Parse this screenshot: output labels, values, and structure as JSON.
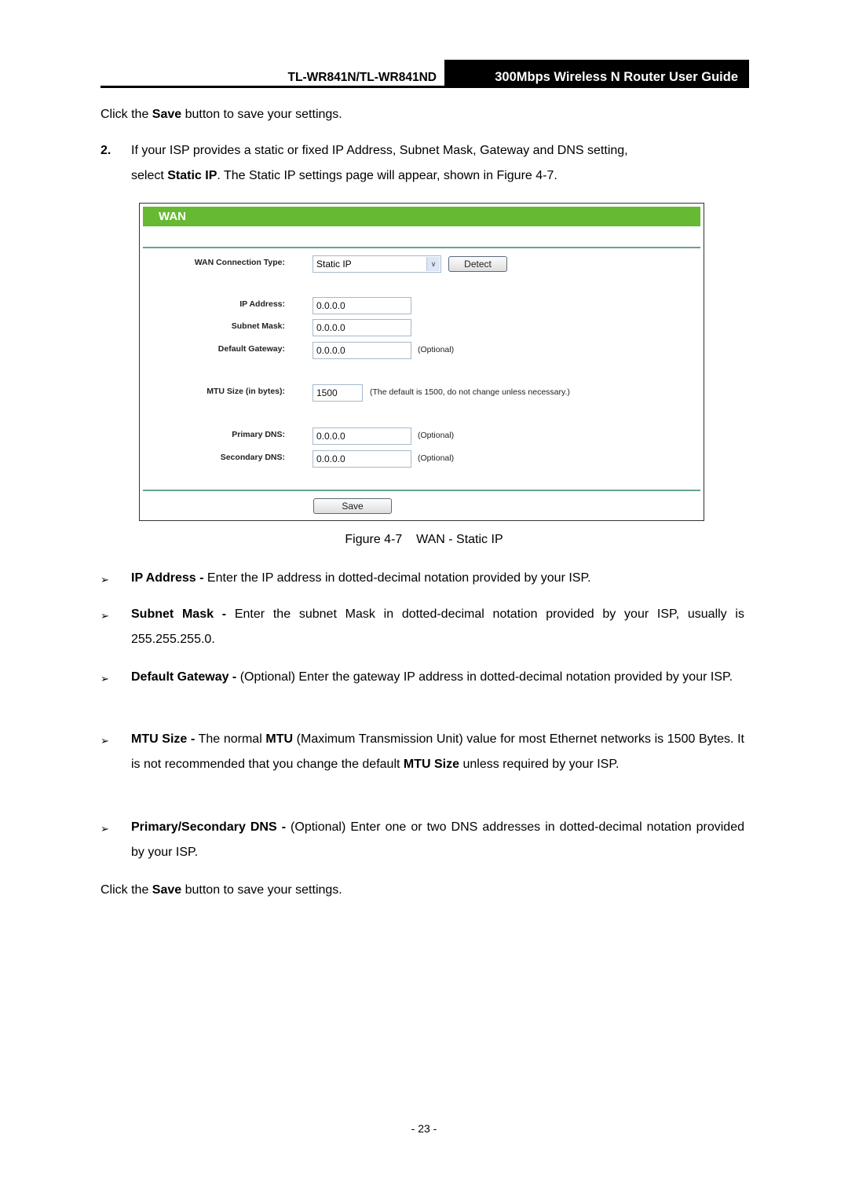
{
  "header": {
    "model": "TL-WR841N/TL-WR841ND",
    "guide_title": "300Mbps Wireless N Router User Guide"
  },
  "intro": {
    "save_line": {
      "pre": "Click the ",
      "bold": "Save",
      "post": " button to save your settings."
    },
    "step2": {
      "number": "2.",
      "line1": "If your ISP provides a static or fixed IP Address, Subnet Mask, Gateway and DNS setting,",
      "line2_pre": "select ",
      "line2_bold": "Static IP",
      "line2_post": ". The Static IP settings page will appear, shown in Figure 4-7."
    }
  },
  "figure": {
    "panel_title": "WAN",
    "connection_type_label": "WAN Connection Type:",
    "connection_type_value": "Static IP",
    "detect_button": "Detect",
    "fields": [
      {
        "label": "IP Address:",
        "value": "0.0.0.0",
        "note": ""
      },
      {
        "label": "Subnet Mask:",
        "value": "0.0.0.0",
        "note": ""
      },
      {
        "label": "Default Gateway:",
        "value": "0.0.0.0",
        "note": "(Optional)"
      }
    ],
    "mtu": {
      "label": "MTU Size (in bytes):",
      "value": "1500",
      "note": "(The default is 1500, do not change unless necessary.)"
    },
    "dns": [
      {
        "label": "Primary DNS:",
        "value": "0.0.0.0",
        "note": "(Optional)"
      },
      {
        "label": "Secondary DNS:",
        "value": "0.0.0.0",
        "note": "(Optional)"
      }
    ],
    "save_button": "Save",
    "caption": "Figure 4-7    WAN - Static IP",
    "colors": {
      "title_bar": "#66b933",
      "divider": "#6aa38a"
    }
  },
  "bullets": [
    {
      "bold": "IP Address -",
      "text": " Enter the IP address in dotted-decimal notation provided by your ISP."
    },
    {
      "bold": "Subnet Mask -",
      "text": " Enter the subnet Mask in dotted-decimal notation provided by your ISP, usually is 255.255.255.0."
    },
    {
      "bold": "Default Gateway -",
      "text": " (Optional) Enter the gateway IP address in dotted-decimal notation provided by your ISP."
    },
    {
      "bold": "MTU Size -",
      "text_a": " The normal ",
      "bold_b": "MTU",
      "text_b": " (Maximum Transmission Unit) value for most Ethernet networks is 1500 Bytes. It is not recommended that you change the default ",
      "bold_c": "MTU Size",
      "text_c": " unless required by your ISP."
    },
    {
      "bold": "Primary/Secondary DNS -",
      "text": " (Optional) Enter one or two DNS addresses in dotted-decimal notation provided by your ISP."
    }
  ],
  "bullet_glyph": "➢",
  "outro": {
    "pre": "Click the ",
    "bold": "Save",
    "post": " button to save your settings."
  },
  "page_number": "- 23 -"
}
